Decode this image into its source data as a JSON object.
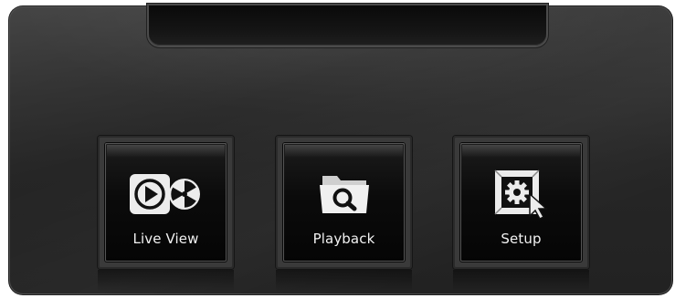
{
  "menu": {
    "tiles": [
      {
        "label": "Live View",
        "icon": "live-view-icon"
      },
      {
        "label": "Playback",
        "icon": "playback-folder-search-icon"
      },
      {
        "label": "Setup",
        "icon": "setup-gear-cursor-icon"
      }
    ]
  },
  "colors": {
    "panel_background": "#2a2a2a",
    "tile_background": "#0b0b0b",
    "label_text": "#f2f2f2"
  }
}
